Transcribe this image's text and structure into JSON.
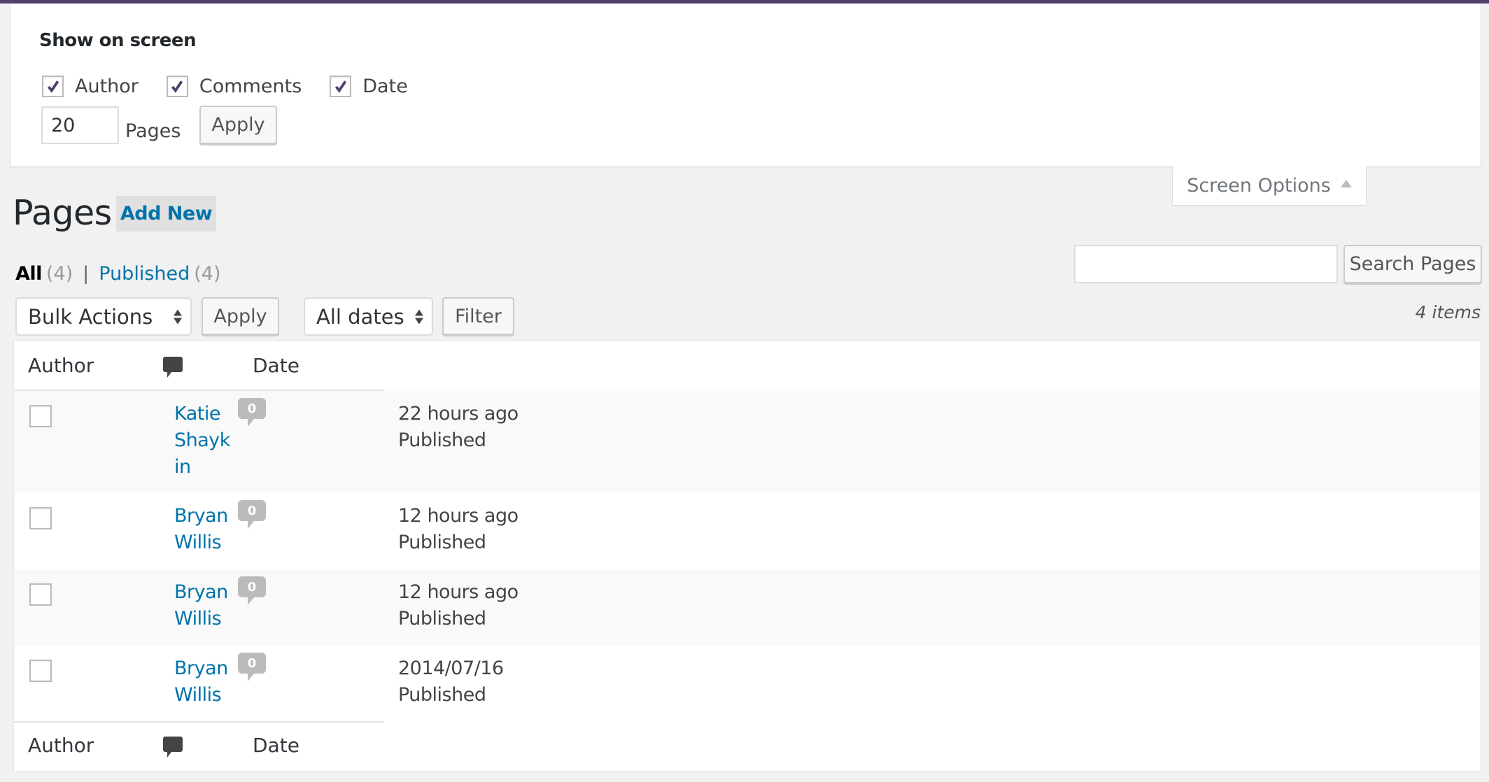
{
  "screen_options": {
    "title": "Show on screen",
    "columns": [
      {
        "label": "Author",
        "checked": true
      },
      {
        "label": "Comments",
        "checked": true
      },
      {
        "label": "Date",
        "checked": true
      }
    ],
    "per_page_value": "20",
    "per_page_label": "Pages",
    "apply_label": "Apply",
    "tab_label": "Screen Options",
    "check_color": "#523f6d"
  },
  "header": {
    "title": "Pages",
    "add_new_label": "Add New"
  },
  "views": {
    "all_label": "All",
    "all_count": "(4)",
    "separator": "|",
    "published_label": "Published",
    "published_count": "(4)"
  },
  "search": {
    "value": "",
    "button_label": "Search Pages"
  },
  "tablenav": {
    "bulk_actions_selected": "Bulk Actions",
    "apply_label": "Apply",
    "dates_selected": "All dates",
    "filter_label": "Filter",
    "items_count": "4 items"
  },
  "table": {
    "columns": {
      "author": "Author",
      "comments_icon": "comment-bubble-icon",
      "date": "Date"
    },
    "rows": [
      {
        "author": "Katie Shaykin",
        "comments": "0",
        "date": "22 hours ago",
        "status": "Published"
      },
      {
        "author": "Bryan Willis",
        "comments": "0",
        "date": "12 hours ago",
        "status": "Published"
      },
      {
        "author": "Bryan Willis",
        "comments": "0",
        "date": "12 hours ago",
        "status": "Published"
      },
      {
        "author": "Bryan Willis",
        "comments": "0",
        "date": "2014/07/16",
        "status": "Published"
      }
    ]
  }
}
